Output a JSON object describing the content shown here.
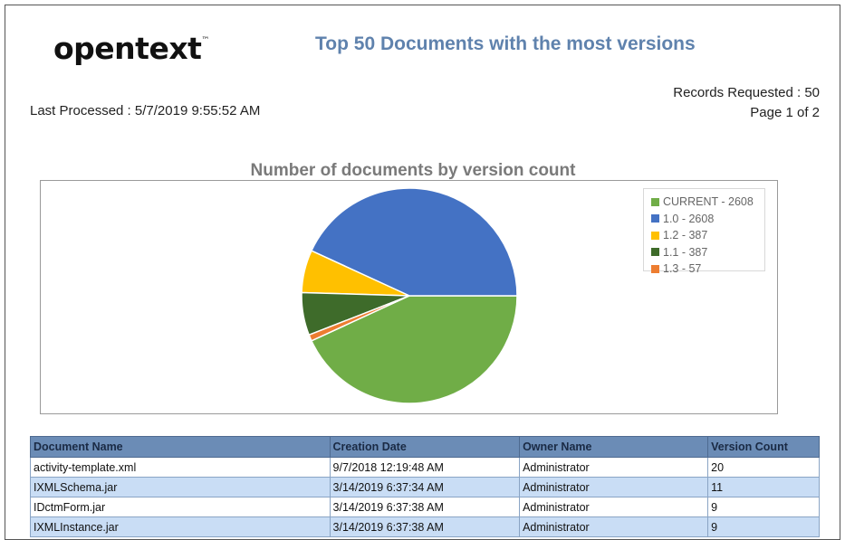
{
  "header": {
    "logo_text": "opentext",
    "logo_tm": "™",
    "title": "Top 50 Documents with the most versions",
    "last_processed": "Last Processed : 5/7/2019 9:55:52 AM",
    "records_requested": "Records Requested : 50",
    "page_info": "Page 1 of 2"
  },
  "chart_data": {
    "type": "pie",
    "title": "Number of documents by version count",
    "legend_position": "top-right",
    "slices": [
      {
        "label": "CURRENT - 2608",
        "name": "CURRENT",
        "value": 2608,
        "color": "#70ad47"
      },
      {
        "label": "1.0 - 2608",
        "name": "1.0",
        "value": 2608,
        "color": "#4472c4"
      },
      {
        "label": "1.2 - 387",
        "name": "1.2",
        "value": 387,
        "color": "#ffc000"
      },
      {
        "label": "1.1 - 387",
        "name": "1.1",
        "value": 387,
        "color": "#3e6b2a"
      },
      {
        "label": "1.3 - 57",
        "name": "1.3",
        "value": 57,
        "color": "#ed7d31"
      }
    ]
  },
  "table": {
    "columns": [
      "Document Name",
      "Creation Date",
      "Owner Name",
      "Version Count"
    ],
    "rows": [
      [
        "activity-template.xml",
        "9/7/2018 12:19:48 AM",
        "Administrator",
        "20"
      ],
      [
        "IXMLSchema.jar",
        "3/14/2019 6:37:34 AM",
        "Administrator",
        "11"
      ],
      [
        "IDctmForm.jar",
        "3/14/2019 6:37:38 AM",
        "Administrator",
        "9"
      ],
      [
        "IXMLInstance.jar",
        "3/14/2019 6:37:38 AM",
        "Administrator",
        "9"
      ]
    ]
  },
  "colors": {
    "title": "#5f82ad",
    "table_header": "#6b8cb6",
    "row_alt": "#c9ddf5"
  }
}
